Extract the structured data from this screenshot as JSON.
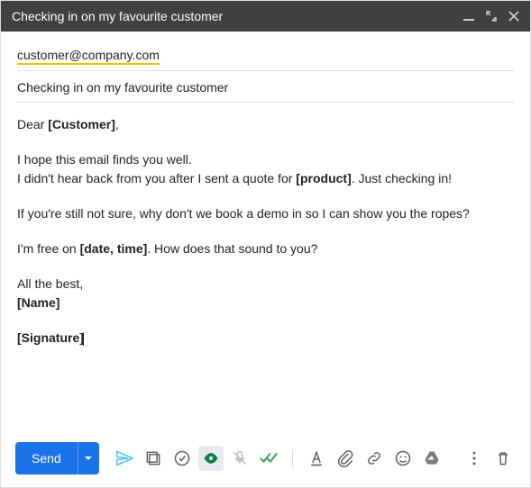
{
  "header": {
    "title": "Checking in on my favourite customer"
  },
  "to": {
    "email": "customer@company.com"
  },
  "subject": "Checking in on my favourite customer",
  "body": {
    "greeting_prefix": "Dear ",
    "greeting_placeholder": "[Customer]",
    "greeting_suffix": ",",
    "line1": "I hope this email finds you well.",
    "line2_prefix": "I didn't hear back from you after I sent a quote for ",
    "line2_placeholder": "[product]",
    "line2_suffix": ". Just checking in!",
    "line3": "If you're still not sure, why don't we book a demo in so I can show you the ropes?",
    "line4_prefix": "I'm free on ",
    "line4_placeholder": "[date, time]",
    "line4_suffix": ". How does that sound to you?",
    "closing": "All the best,",
    "name_placeholder": "[Name]",
    "signature_placeholder": "[Signature]"
  },
  "toolbar": {
    "send_label": "Send"
  }
}
